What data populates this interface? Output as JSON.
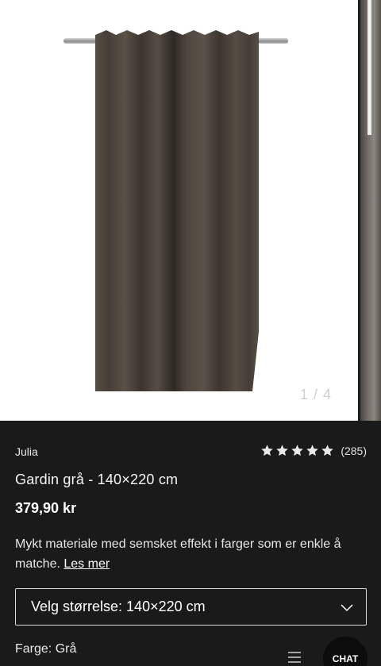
{
  "gallery": {
    "counter": "1 / 4"
  },
  "product": {
    "brand": "Julia",
    "rating": {
      "stars": 5,
      "count": "(285)"
    },
    "title": "Gardin grå - 140×220 cm",
    "price": "379,90 kr",
    "description": "Mykt materiale med semsket effekt i farger som er enkle å matche.",
    "read_more": "Les mer"
  },
  "size_select": {
    "label": "Velg størrelse: 140×220 cm"
  },
  "color": {
    "label": "Farge:",
    "value": "Grå"
  },
  "chat": {
    "label": "CHAT"
  },
  "colors": {
    "background": "#1a1a1a",
    "curtain": "#4a423a"
  },
  "icons": [
    "star-icon",
    "chevron-down-icon",
    "menu-icon"
  ]
}
